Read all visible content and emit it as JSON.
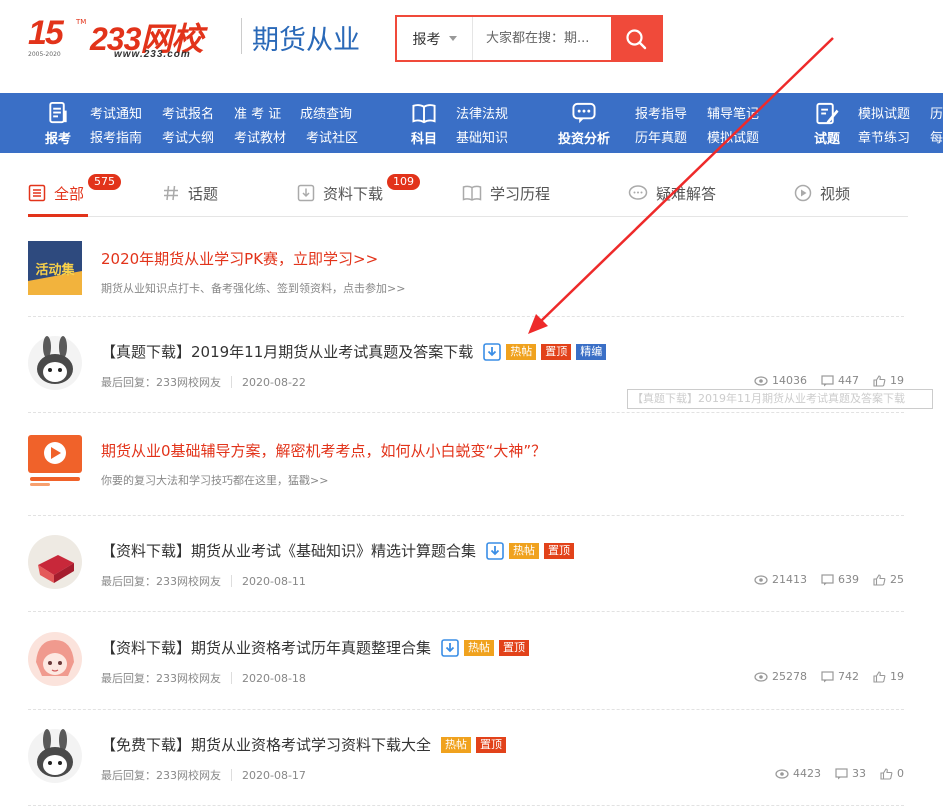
{
  "header": {
    "logo_15": "15",
    "logo_tm": "TM",
    "logo_years": "2005-2020",
    "logo_233": "233网校",
    "logo_url": "www.233.com",
    "brand_name": "期货从业",
    "search": {
      "select_value": "报考",
      "placeholder": "大家都在搜：期..."
    }
  },
  "nav": {
    "groups": [
      {
        "icon_label": "报考",
        "links": [
          "考试通知",
          "考试报名",
          "准 考 证",
          "成绩查询",
          "报考指南",
          "考试大纲",
          "考试教材",
          "考试社区"
        ]
      },
      {
        "icon_label": "科目",
        "links": [
          "法律法规",
          "基础知识"
        ]
      },
      {
        "icon_label": "投资分析",
        "links": [
          "报考指导",
          "辅导笔记",
          "历年真题",
          "模拟试题"
        ]
      },
      {
        "icon_label": "试题",
        "links": [
          "模拟试题",
          "历",
          "章节练习",
          "每"
        ]
      }
    ]
  },
  "tabs": [
    {
      "label": "全部",
      "badge": "575"
    },
    {
      "label": "话题"
    },
    {
      "label": "资料下载",
      "badge": "109"
    },
    {
      "label": "学习历程"
    },
    {
      "label": "疑难解答"
    },
    {
      "label": "视频"
    }
  ],
  "tags": {
    "hot": "热帖",
    "top": "置顶",
    "edit": "精编"
  },
  "list": [
    {
      "type": "promo",
      "thumb_text": "活动集",
      "title": "2020年期货从业学习PK赛，立即学习>>",
      "desc": "期货从业知识点打卡、备考强化练、签到领资料，点击参加>>"
    },
    {
      "type": "post",
      "title": "【真题下载】2019年11月期货从业考试真题及答案下载",
      "author": "最后回复：233网校网友",
      "date": "2020-08-22",
      "views": "14036",
      "comments": "447",
      "likes": "19"
    },
    {
      "type": "promo",
      "title": "期货从业0基础辅导方案，解密机考考点，如何从小白蜕变“大神”？",
      "desc": "你要的复习大法和学习技巧都在这里，猛戳>>"
    },
    {
      "type": "post",
      "title": "【资料下载】期货从业考试《基础知识》精选计算题合集",
      "author": "最后回复：233网校网友",
      "date": "2020-08-11",
      "views": "21413",
      "comments": "639",
      "likes": "25"
    },
    {
      "type": "post",
      "title": "【资料下载】期货从业资格考试历年真题整理合集",
      "author": "最后回复：233网校网友",
      "date": "2020-08-18",
      "views": "25278",
      "comments": "742",
      "likes": "19"
    },
    {
      "type": "post",
      "title": "【免费下载】期货从业资格考试学习资料下载大全",
      "author": "最后回复：233网校网友",
      "date": "2020-08-17",
      "views": "4423",
      "comments": "33",
      "likes": "0"
    }
  ],
  "tooltip": "【真题下载】2019年11月期货从业考试真题及答案下载",
  "colors": {
    "brand_red": "#e2331a",
    "nav_blue": "#3a6fc6",
    "hot_tag": "#f0a21e",
    "top_tag": "#e2421a"
  }
}
